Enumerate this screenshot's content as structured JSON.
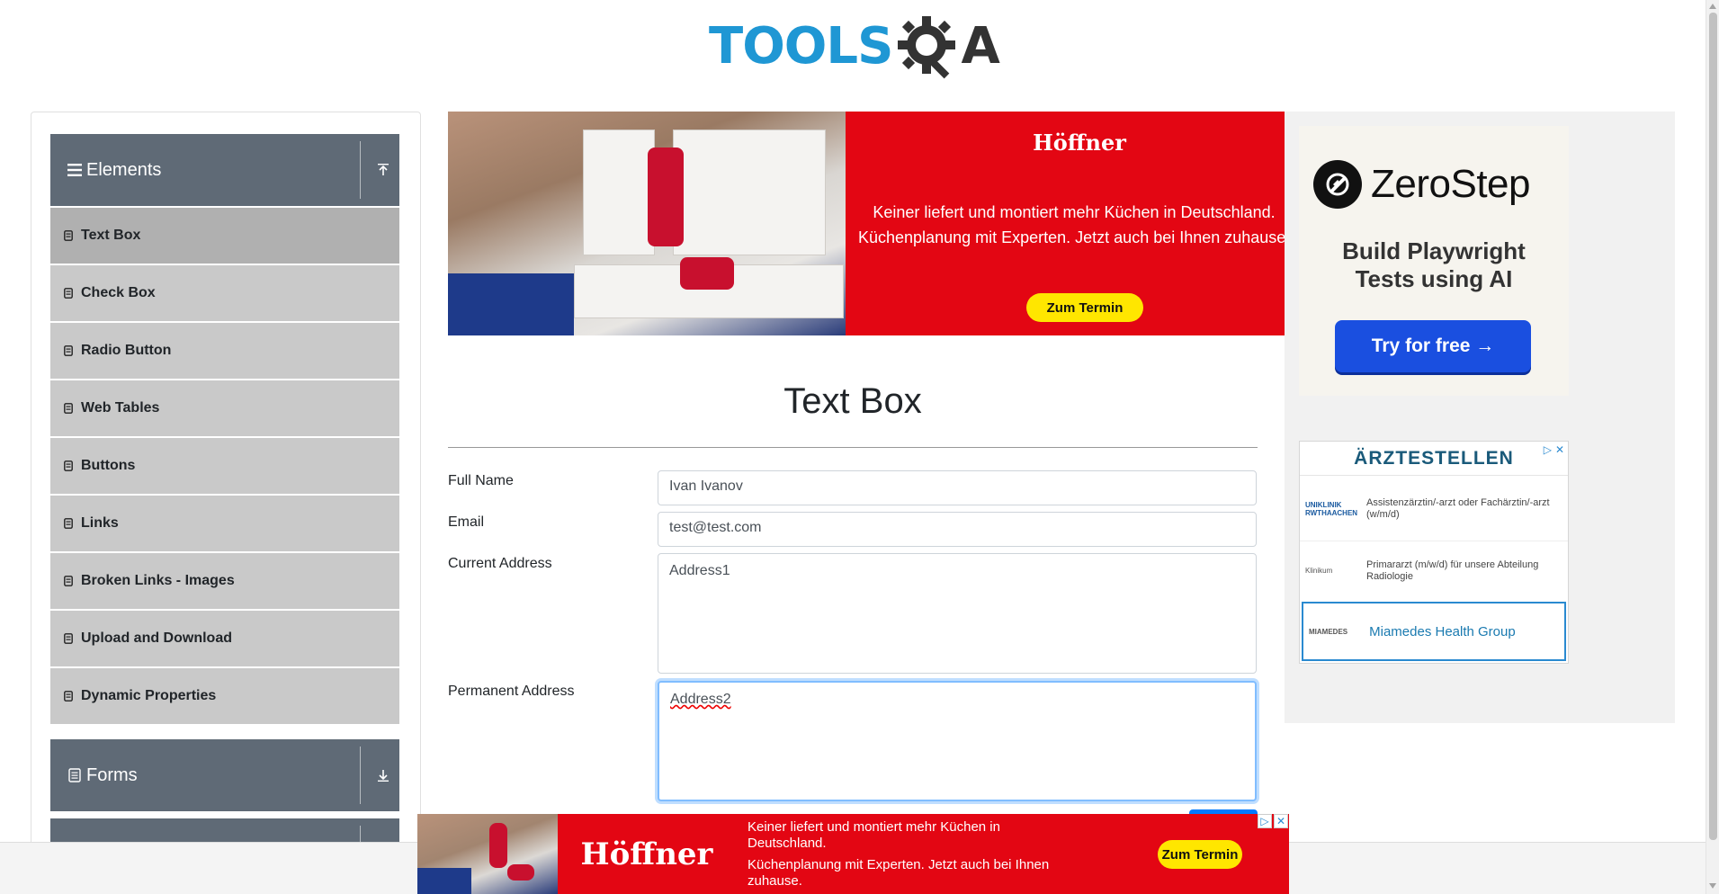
{
  "header": {
    "logo_text": "TOOLS",
    "logo_suffix": "A"
  },
  "sidebar": {
    "groups": [
      {
        "label": "Elements",
        "expanded": true
      },
      {
        "label": "Forms",
        "expanded": false
      }
    ],
    "items": [
      {
        "label": "Text Box",
        "active": true
      },
      {
        "label": "Check Box"
      },
      {
        "label": "Radio Button"
      },
      {
        "label": "Web Tables"
      },
      {
        "label": "Buttons"
      },
      {
        "label": "Links"
      },
      {
        "label": "Broken Links - Images"
      },
      {
        "label": "Upload and Download"
      },
      {
        "label": "Dynamic Properties"
      }
    ]
  },
  "top_ad": {
    "brand": "Höffner",
    "line1": "Keiner liefert und montiert mehr Küchen in Deutschland.",
    "line2": "Küchenplanung mit Experten. Jetzt auch bei Ihnen zuhause.",
    "button": "Zum Termin"
  },
  "main": {
    "title": "Text Box",
    "fields": {
      "full_name": {
        "label": "Full Name",
        "value": "Ivan Ivanov"
      },
      "email": {
        "label": "Email",
        "value": "test@test.com"
      },
      "current_address": {
        "label": "Current Address",
        "value": "Address1"
      },
      "permanent_address": {
        "label": "Permanent Address",
        "value": "Address2"
      }
    }
  },
  "right_ad": {
    "zerostep": {
      "name": "ZeroStep",
      "tagline_1": "Build Playwright",
      "tagline_2": "Tests using AI",
      "button": "Try for free →"
    },
    "aerzte": {
      "title": "ÄRZTESTELLEN",
      "jobs": [
        {
          "logo": "UNIKLINIK RWTHAACHEN",
          "text": "Assistenzärztin/-arzt oder Fachärztin/-arzt (w/m/d)"
        },
        {
          "logo": "Klinikum",
          "text": "Primararzt (m/w/d) für unsere Abteilung Radiologie"
        },
        {
          "logo": "MIAMEDES",
          "text": "Miamedes Health Group"
        }
      ]
    }
  },
  "bottom_ad": {
    "brand": "Höffner",
    "line1": "Keiner liefert und montiert mehr Küchen in Deutschland.",
    "line2": "Küchenplanung mit Experten. Jetzt auch bei Ihnen zuhause.",
    "button": "Zum Termin"
  },
  "colors": {
    "brand_blue": "#1f97d4",
    "sidebar_header": "#5f6a76",
    "ad_red": "#e30613",
    "focus_blue": "#80bdff"
  }
}
